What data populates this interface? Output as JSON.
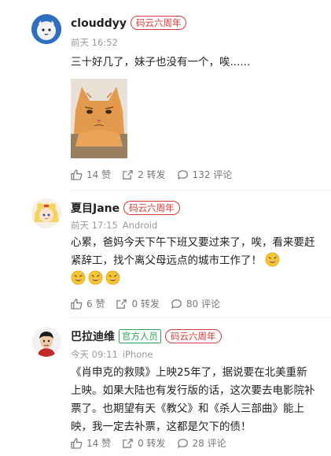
{
  "posts": [
    {
      "username": "clouddyy",
      "badge": "码云六周年",
      "time": "前天 16:52",
      "text": "三十好几了，妹子也没有一个，唉......",
      "likes_label": "14 赞",
      "reposts_label": "2 转发",
      "comments_label": "132 评论"
    },
    {
      "username": "夏目Jane",
      "badge": "码云六周年",
      "time": "前天 17:15",
      "device": "Android",
      "text": "心累，爸妈今天下午下班又要过来了，唉，看来要赶紧辞工，找个离父母远点的城市工作了！",
      "likes_label": "6 赞",
      "reposts_label": "0 转发",
      "comments_label": "80 评论"
    },
    {
      "username": "巴拉迪维",
      "official_badge": "官方人员",
      "badge": "码云六周年",
      "time": "今天 09:11",
      "device": "iPhone",
      "text": "《肖申克的救赎》上映25年了，据说要在北美重新上映。如果大陆也有发行版的话，这次要去电影院补票了。也期望有天《教父》和《杀人三部曲》能上映，我一定去补票，这都是欠下的债！",
      "likes_label": "14 赞",
      "reposts_label": "0 转发",
      "comments_label": "28 评论"
    }
  ],
  "colors": {
    "badge_red": "#d53a3a",
    "badge_green": "#2ea556",
    "meta_gray": "#999999"
  },
  "icons": [
    "thumb-up-icon",
    "share-icon",
    "comment-icon",
    "sweat-emoji-icon"
  ]
}
